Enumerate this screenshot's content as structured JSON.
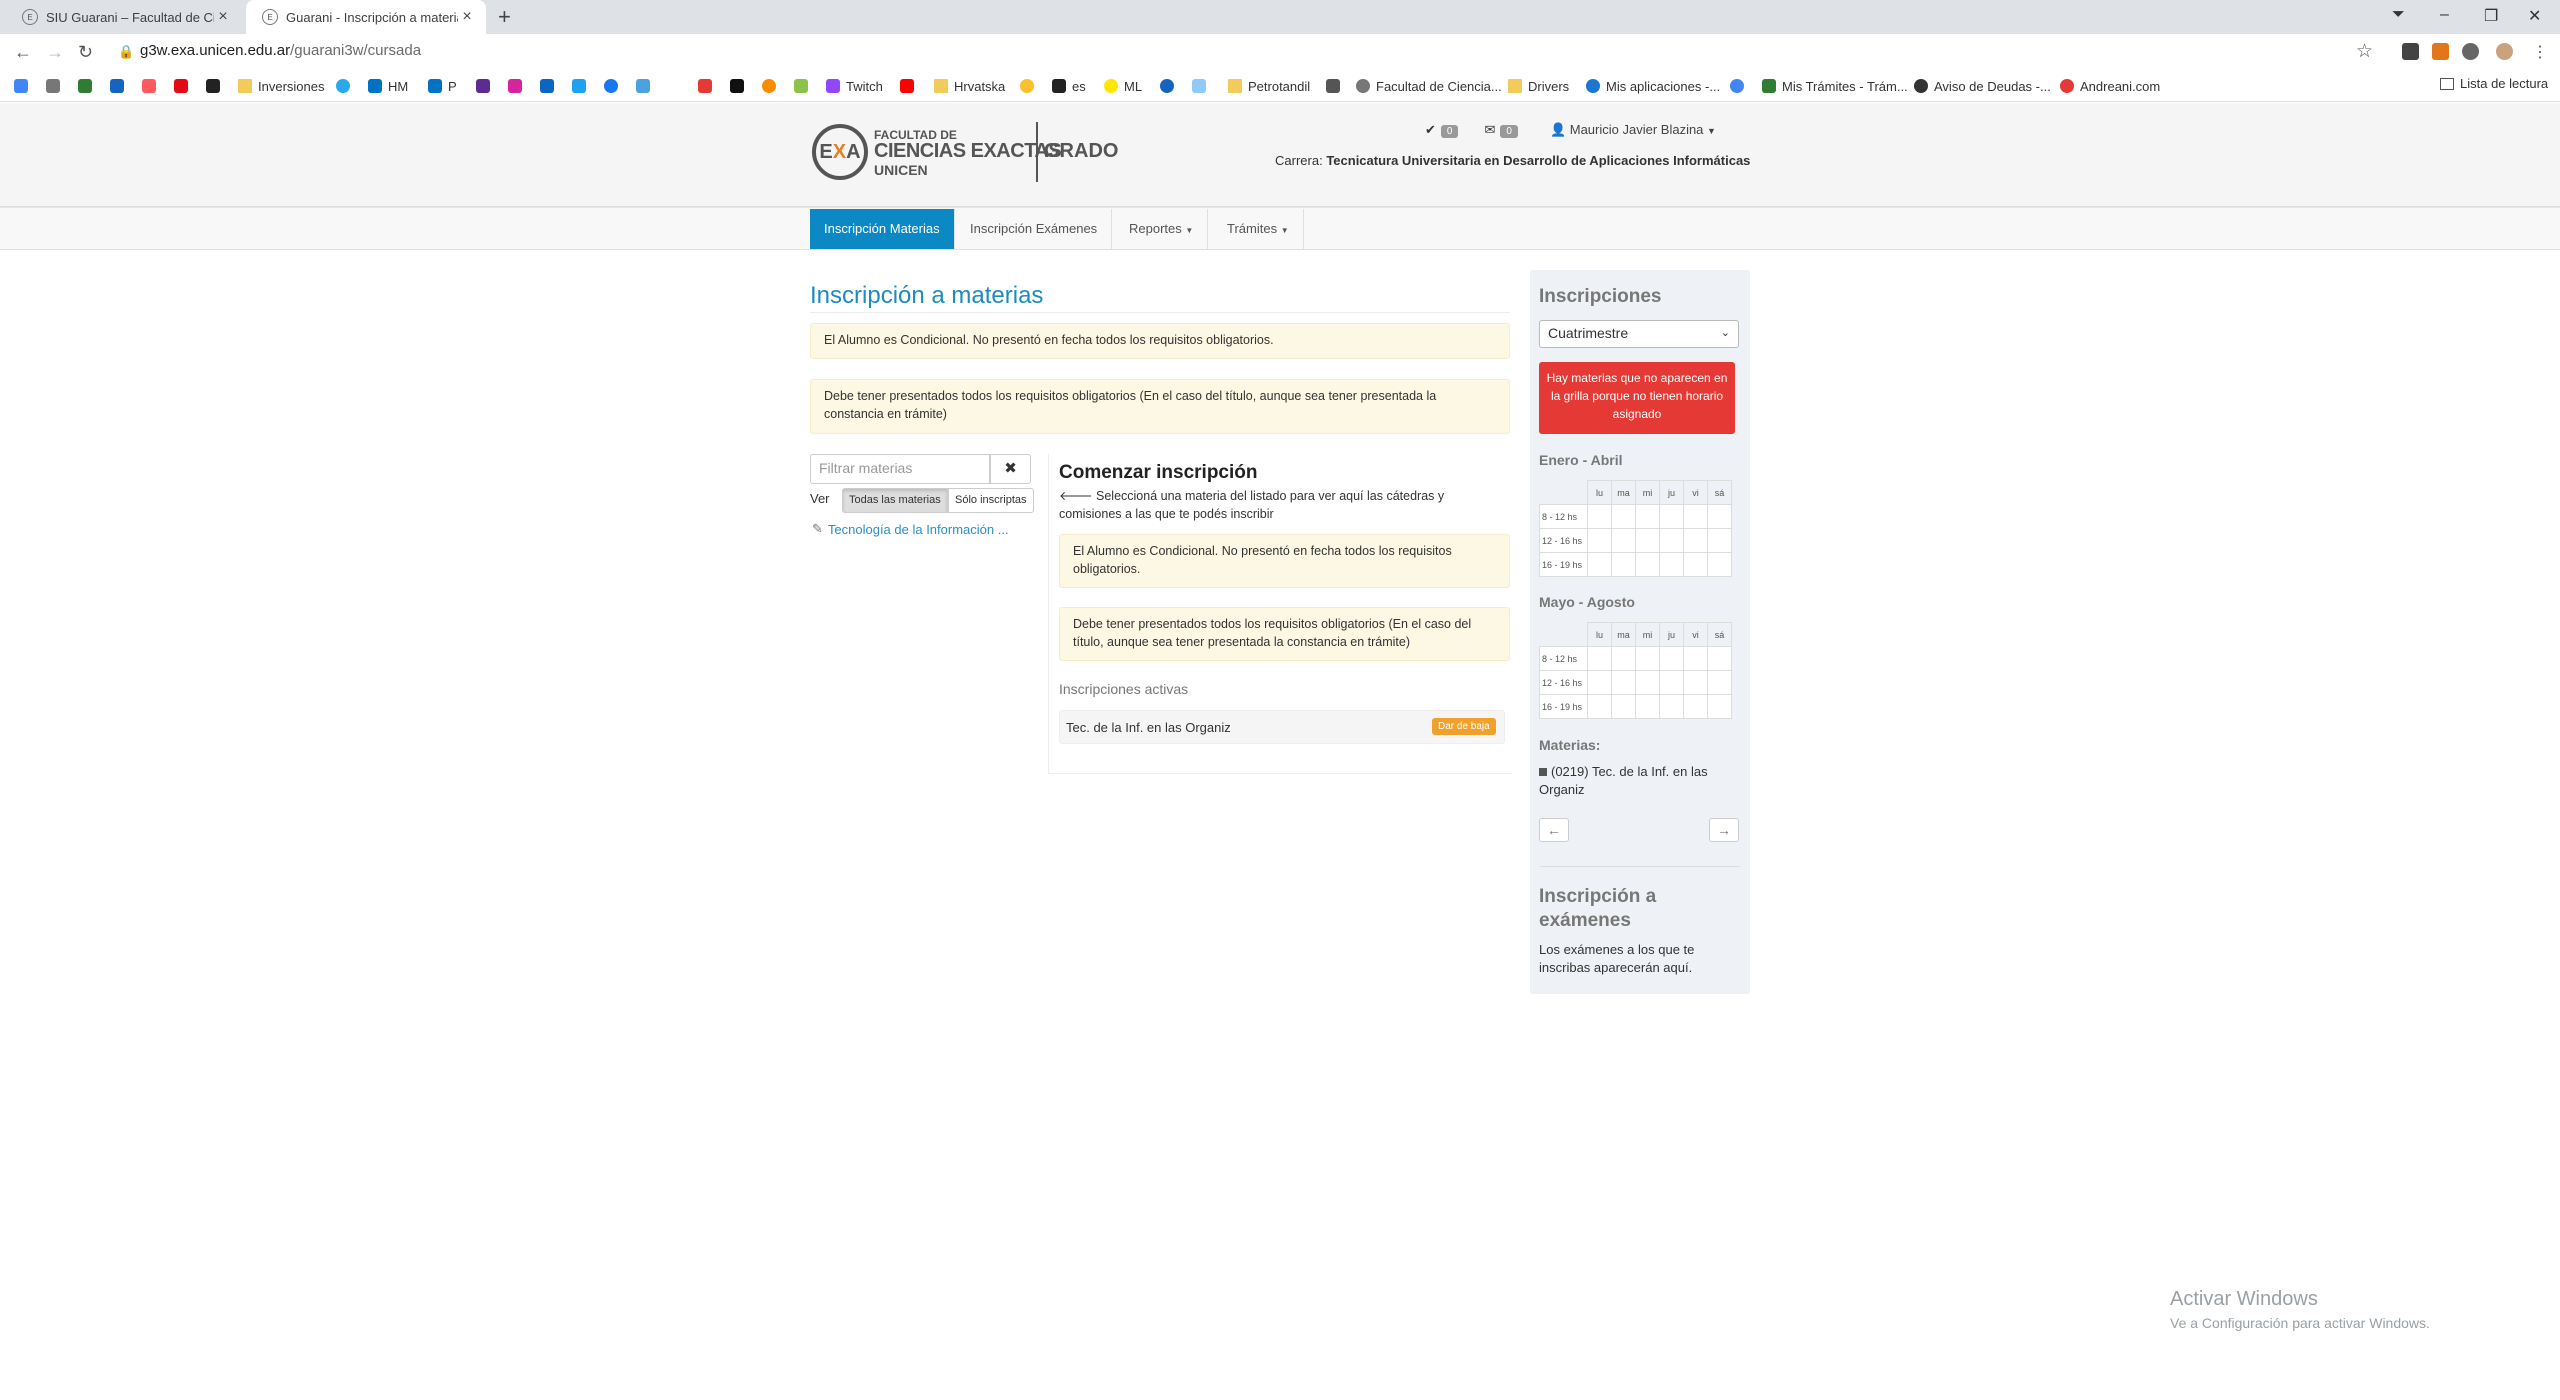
{
  "browser": {
    "tabs": [
      {
        "title": "SIU Guarani – Facultad de Ciencias",
        "active": false
      },
      {
        "title": "Guarani - Inscripción a materias",
        "active": true
      }
    ],
    "url_host": "g3w.exa.unicen.edu.ar",
    "url_path": "/guarani3w/cursada",
    "bookmarks": [
      "Inversiones",
      "HM",
      "P",
      "Twitch",
      "Hrvatska",
      "es",
      "ML",
      "Petrotandil",
      "Facultad de Ciencia...",
      "Drivers",
      "Mis aplicaciones -...",
      "Mis Trámites - Trám...",
      "Aviso de Deudas -...",
      "Andreani.com"
    ],
    "reading_list": "Lista de lectura"
  },
  "header": {
    "logo_line1": "FACULTAD DE",
    "logo_line2": "CIENCIAS EXACTAS",
    "logo_line3": "UNICEN",
    "logo_grado": "GRADO",
    "notif_count": "0",
    "mail_count": "0",
    "user_name": "Mauricio Javier Blazina",
    "carrera_label": "Carrera:",
    "carrera_value": "Tecnicatura Universitaria en Desarrollo de Aplicaciones Informáticas"
  },
  "menu": {
    "items": [
      "Inscripción Materias",
      "Inscripción Exámenes",
      "Reportes",
      "Trámites"
    ]
  },
  "main": {
    "title": "Inscripción a materias",
    "alert1": "El Alumno es Condicional. No presentó en fecha todos los requisitos obligatorios.",
    "alert2": "Debe tener presentados todos los requisitos obligatorios (En el caso del título, aunque sea tener presentada la constancia en trámite)",
    "filter_placeholder": "Filtrar materias",
    "ver_label": "Ver",
    "btn_todas": "Todas las materias",
    "btn_solo": "Sólo inscriptas",
    "materia_item": "Tecnología de la Información ..."
  },
  "panel": {
    "title": "Comenzar inscripción",
    "hint": "Seleccioná una materia del listado para ver aquí las cátedras y comisiones a las que te podés inscribir",
    "alert1": "El Alumno es Condicional. No presentó en fecha todos los requisitos obligatorios.",
    "alert2": "Debe tener presentados todos los requisitos obligatorios (En el caso del título, aunque sea tener presentada la constancia en trámite)",
    "active_heading": "Inscripciones activas",
    "active_item": "Tec. de la Inf. en las Organiz",
    "baja_button": "Dar de baja"
  },
  "sidebar": {
    "title": "Inscripciones",
    "period_select": "Cuatrimestre",
    "warning": "Hay materias que no aparecen en la grilla porque no tienen horario asignado",
    "sem1": "Enero - Abril",
    "sem2": "Mayo - Agosto",
    "days": [
      "lu",
      "ma",
      "mi",
      "ju",
      "vi",
      "sá"
    ],
    "slots": [
      "8 - 12 hs",
      "12 - 16 hs",
      "16 - 19 hs"
    ],
    "materias_label": "Materias:",
    "materia": "(0219) Tec. de la Inf. en las Organiz",
    "prev": "←",
    "next": "→",
    "examenes_title": "Inscripción a exámenes",
    "examenes_text": "Los exámenes a los que te inscribas aparecerán aquí."
  },
  "watermark": {
    "line1": "Activar Windows",
    "line2": "Ve a Configuración para activar Windows."
  }
}
